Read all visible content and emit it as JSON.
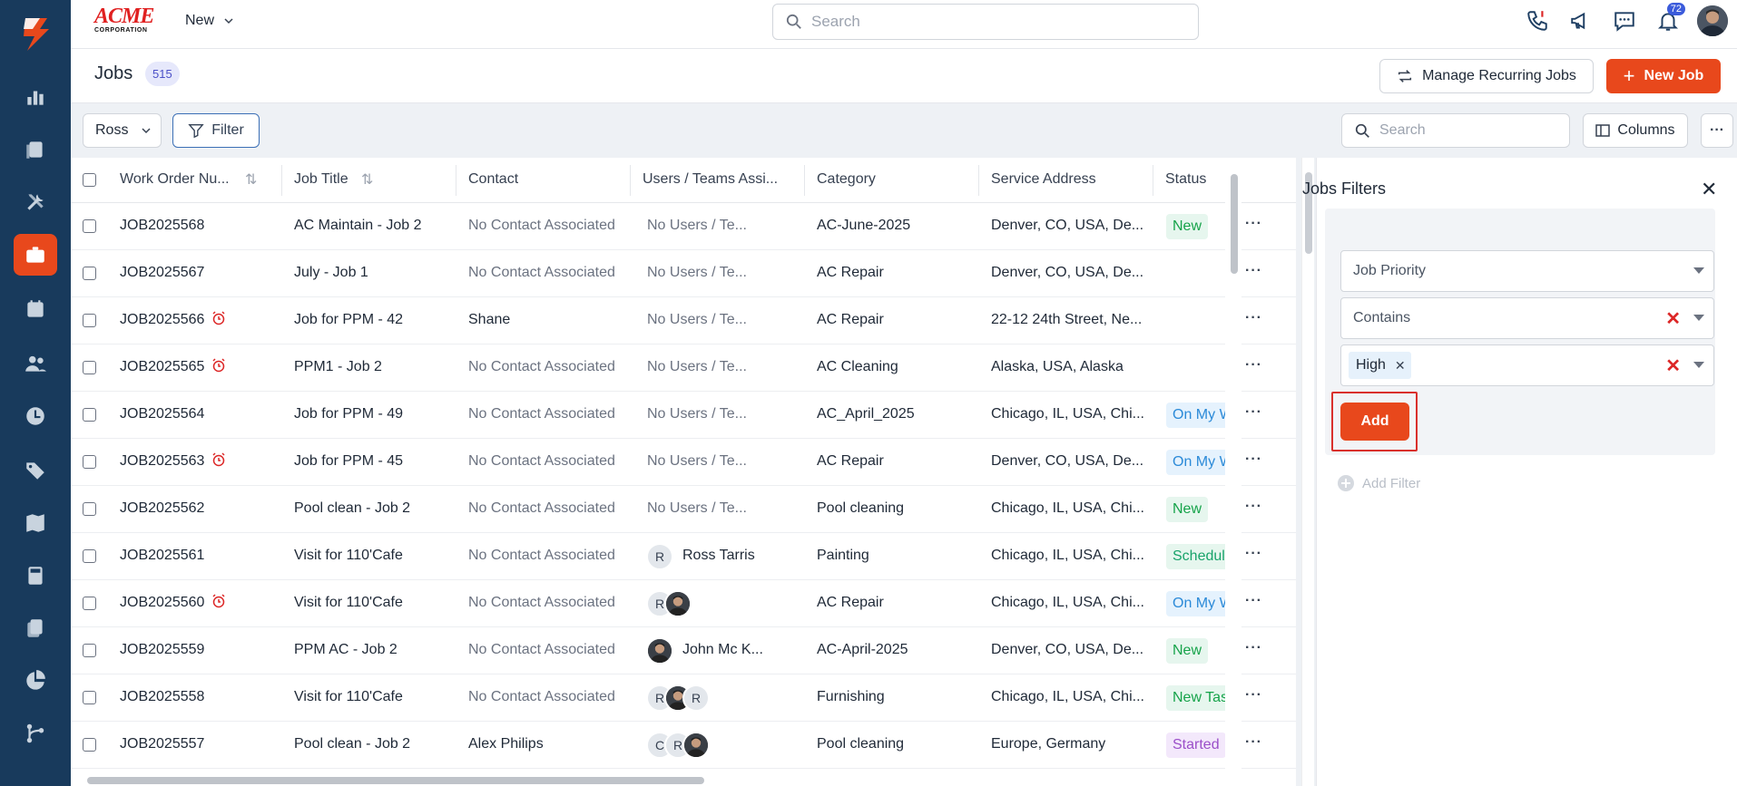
{
  "brand": {
    "name": "ACME",
    "sub": "CORPORATION"
  },
  "topbar": {
    "new_label": "New",
    "search_placeholder": "Search",
    "notification_count": "72"
  },
  "header": {
    "title": "Jobs",
    "count": "515",
    "recurring_label": "Manage Recurring Jobs",
    "new_job_label": "New Job"
  },
  "toolbar": {
    "ross_label": "Ross",
    "filter_label": "Filter",
    "search_placeholder": "Search",
    "columns_label": "Columns",
    "more_label": "···"
  },
  "table": {
    "columns": [
      "Work Order Nu...",
      "Job Title",
      "Contact",
      "Users / Teams Assi...",
      "Category",
      "Service Address",
      "Status"
    ],
    "rows": [
      {
        "wo": "JOB2025568",
        "alarm": false,
        "title": "AC Maintain - Job 2",
        "contact": "No Contact Associated",
        "contact_muted": true,
        "users": "No Users / Te...",
        "users_type": "text",
        "category": "AC-June-2025",
        "address": "Denver, CO, USA, De...",
        "status": "New",
        "status_type": "new"
      },
      {
        "wo": "JOB2025567",
        "alarm": false,
        "title": "July - Job 1",
        "contact": "No Contact Associated",
        "contact_muted": true,
        "users": "No Users / Te...",
        "users_type": "text",
        "category": "AC Repair",
        "address": "Denver, CO, USA, De...",
        "status": "",
        "status_type": ""
      },
      {
        "wo": "JOB2025566",
        "alarm": true,
        "title": "Job for PPM - 42",
        "contact": "Shane",
        "contact_muted": false,
        "users": "No Users / Te...",
        "users_type": "text",
        "category": "AC Repair",
        "address": "22-12 24th Street, Ne...",
        "status": "",
        "status_type": ""
      },
      {
        "wo": "JOB2025565",
        "alarm": true,
        "title": "PPM1 - Job 2",
        "contact": "No Contact Associated",
        "contact_muted": true,
        "users": "No Users / Te...",
        "users_type": "text",
        "category": "AC Cleaning",
        "address": "Alaska, USA, Alaska",
        "status": "",
        "status_type": ""
      },
      {
        "wo": "JOB2025564",
        "alarm": false,
        "title": "Job for PPM - 49",
        "contact": "No Contact Associated",
        "contact_muted": true,
        "users": "No Users / Te...",
        "users_type": "text",
        "category": "AC_April_2025",
        "address": "Chicago, IL, USA, Chi...",
        "status": "On My W",
        "status_type": "onmy"
      },
      {
        "wo": "JOB2025563",
        "alarm": true,
        "title": "Job for PPM - 45",
        "contact": "No Contact Associated",
        "contact_muted": true,
        "users": "No Users / Te...",
        "users_type": "text",
        "category": "AC Repair",
        "address": "Denver, CO, USA, De...",
        "status": "On My W",
        "status_type": "onmy"
      },
      {
        "wo": "JOB2025562",
        "alarm": false,
        "title": "Pool clean - Job 2",
        "contact": "No Contact Associated",
        "contact_muted": true,
        "users": "No Users / Te...",
        "users_type": "text",
        "category": "Pool cleaning",
        "address": "Chicago, IL, USA, Chi...",
        "status": "New",
        "status_type": "new"
      },
      {
        "wo": "JOB2025561",
        "alarm": false,
        "title": "Visit for 110'Cafe",
        "contact": "No Contact Associated",
        "contact_muted": true,
        "users": "Ross Tarris",
        "users_type": "R",
        "category": "Painting",
        "address": "Chicago, IL, USA, Chi...",
        "status": "Schedul",
        "status_type": "sched"
      },
      {
        "wo": "JOB2025560",
        "alarm": true,
        "title": "Visit for 110'Cafe",
        "contact": "No Contact Associated",
        "contact_muted": true,
        "users": "",
        "users_type": "R+photo",
        "category": "AC Repair",
        "address": "Chicago, IL, USA, Chi...",
        "status": "On My W",
        "status_type": "onmy"
      },
      {
        "wo": "JOB2025559",
        "alarm": false,
        "title": "PPM AC - Job 2",
        "contact": "No Contact Associated",
        "contact_muted": true,
        "users": "John Mc K...",
        "users_type": "photo",
        "category": "AC-April-2025",
        "address": "Denver, CO, USA, De...",
        "status": "New",
        "status_type": "new"
      },
      {
        "wo": "JOB2025558",
        "alarm": false,
        "title": "Visit for 110'Cafe",
        "contact": "No Contact Associated",
        "contact_muted": true,
        "users": "",
        "users_type": "R+photo+R",
        "category": "Furnishing",
        "address": "Chicago, IL, USA, Chi...",
        "status": "New Tas",
        "status_type": "newtask"
      },
      {
        "wo": "JOB2025557",
        "alarm": false,
        "title": "Pool clean - Job 2",
        "contact": "Alex Philips",
        "contact_muted": false,
        "users": "",
        "users_type": "C+R+photo",
        "category": "Pool cleaning",
        "address": "Europe, Germany",
        "status": "Started",
        "status_type": "started"
      }
    ]
  },
  "filters_panel": {
    "title": "Jobs Filters",
    "field_label": "Job Priority",
    "operator_label": "Contains",
    "chip_label": "High",
    "add_label": "Add",
    "add_filter_label": "Add Filter"
  },
  "colors": {
    "sidebar": "#183a5c",
    "accent": "#e8481c",
    "highlight": "#d9302c"
  },
  "icons": [
    "chart-bar-icon",
    "clipboard-icon",
    "tools-icon",
    "briefcase-icon",
    "calendar-icon",
    "users-icon",
    "clock-icon",
    "tag-icon",
    "map-icon",
    "calculator-icon",
    "documents-icon",
    "pie-chart-icon",
    "workflow-icon"
  ]
}
